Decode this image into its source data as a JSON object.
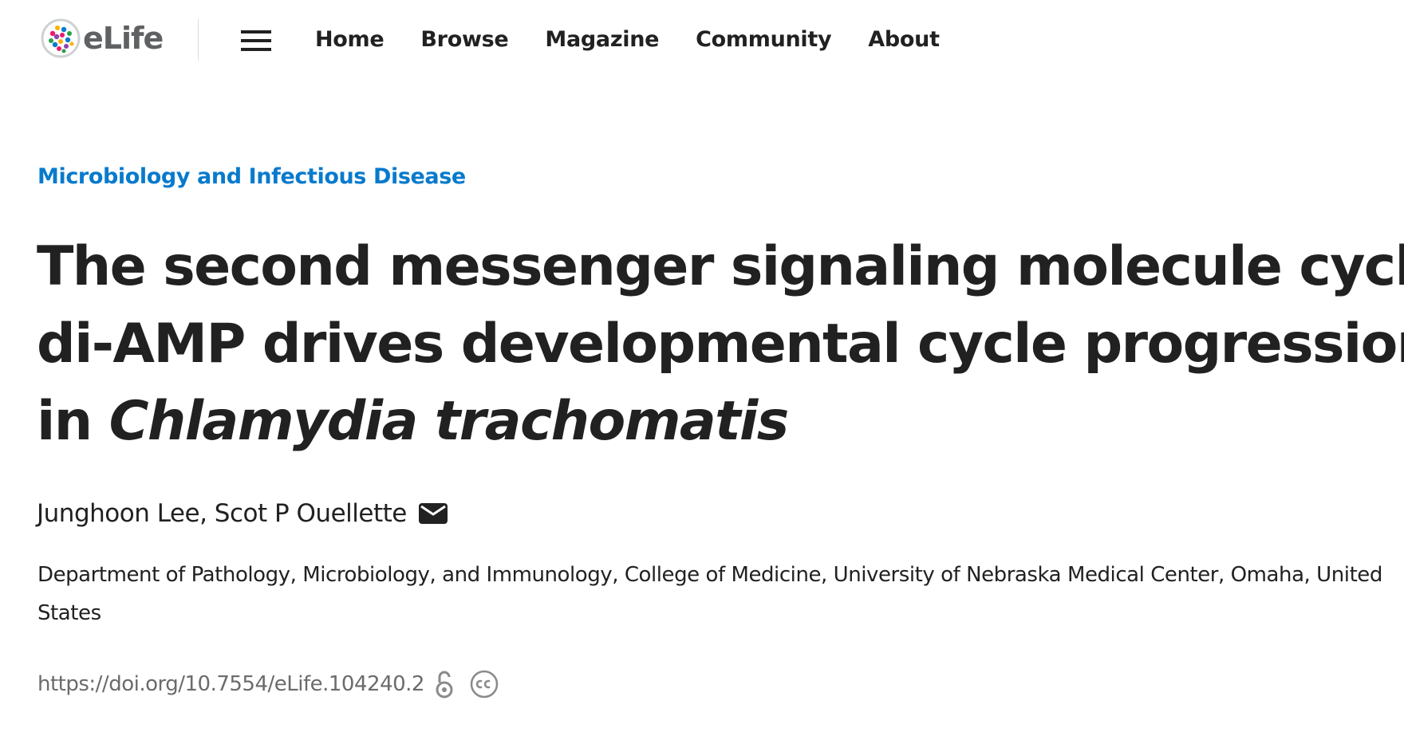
{
  "header": {
    "logo_text": "eLife",
    "menu_icon": "hamburger-menu-icon",
    "nav": [
      {
        "label": "Home"
      },
      {
        "label": "Browse"
      },
      {
        "label": "Magazine"
      },
      {
        "label": "Community"
      },
      {
        "label": "About"
      }
    ]
  },
  "article": {
    "subject": "Microbiology and Infectious Disease",
    "title_line1": "The second messenger signaling molecule cyclic",
    "title_line2": "di-AMP drives developmental cycle progression",
    "title_line3_prefix": "in ",
    "title_line3_italic": "Chlamydia trachomatis",
    "authors": "Junghoon Lee, Scot P Ouellette",
    "author_icon": "mail-icon",
    "affiliation": "Department of Pathology, Microbiology, and Immunology, College of Medicine, University of Nebraska Medical Center, Omaha, United States",
    "doi": "https://doi.org/10.7554/eLife.104240.2",
    "doi_icons": [
      "open-access-icon",
      "creative-commons-icon"
    ]
  },
  "colors": {
    "accent_link": "#087acc",
    "text": "#212121",
    "muted": "#6b6b6b"
  }
}
